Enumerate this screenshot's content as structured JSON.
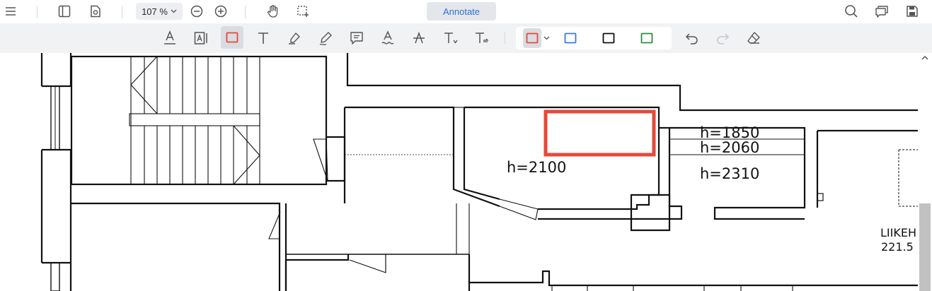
{
  "toolbar": {
    "zoom_value": "107 %",
    "annotate_label": "Annotate",
    "icons": [
      "menu-icon",
      "sidebar-icon",
      "settings-document-icon",
      "zoom-out-icon",
      "zoom-in-icon",
      "hand-tool-icon",
      "selection-icon",
      "search-icon",
      "comments-icon",
      "save-icon"
    ]
  },
  "annotation_tools": [
    "text-underline-icon",
    "text-area-icon",
    "rectangle-icon",
    "text-icon",
    "highlighter-icon",
    "freehand-pen-icon",
    "comment-icon",
    "squiggly-icon",
    "strikethrough-icon",
    "insert-text-icon",
    "replace-text-icon"
  ],
  "shape_colors": {
    "selected": "#e5493a",
    "blue": "#3b7be0",
    "black": "#111111",
    "green": "#2e8b3e"
  },
  "history_tools": [
    "undo-icon",
    "redo-icon",
    "eraser-icon"
  ],
  "document": {
    "labels": {
      "h1850": "h=1850",
      "h2060": "h=2060",
      "h2310": "h=2310",
      "h2100": "h=2100",
      "liikeh": "LIIKEH",
      "area": "221.5"
    },
    "annotation_color": "#e5493a"
  }
}
